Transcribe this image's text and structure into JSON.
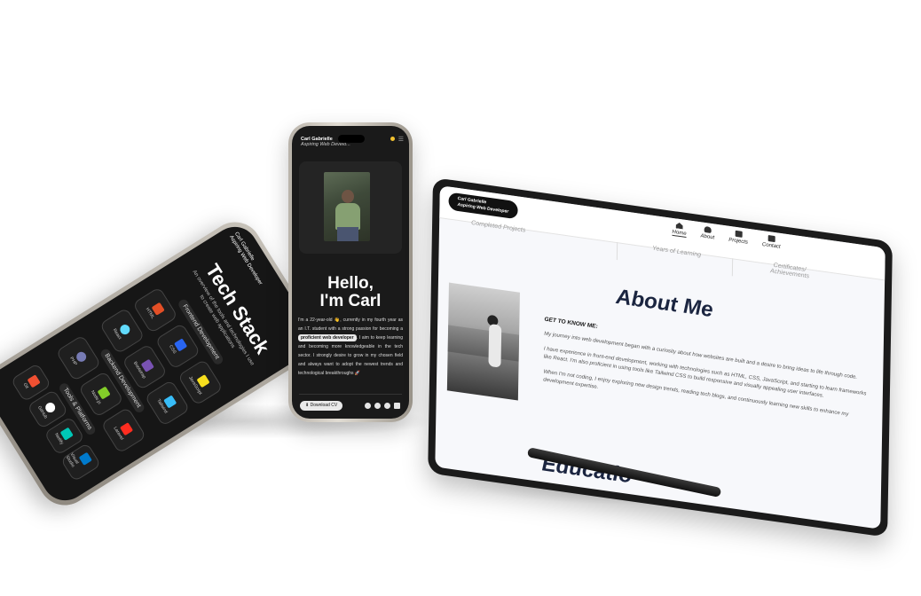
{
  "left_phone": {
    "header": [
      "Carl Gabrielle",
      "Aspiring Web Developer"
    ],
    "title": "Tech Stack",
    "subtitle": "An overview of the tools and technologies I use to create web applications",
    "sections": [
      {
        "label": "Frontend Development",
        "items": [
          {
            "name": "HTML",
            "color": "#e34f26"
          },
          {
            "name": "CSS",
            "color": "#2965f1"
          },
          {
            "name": "JavaScript",
            "color": "#f7df1e"
          },
          {
            "name": "React",
            "color": "#61dafb"
          },
          {
            "name": "Bootstrap",
            "color": "#7952b3"
          },
          {
            "name": "Tailwind",
            "color": "#38bdf8"
          }
        ]
      },
      {
        "label": "Backend Development",
        "items": [
          {
            "name": "PHP",
            "color": "#777bb4"
          },
          {
            "name": "Node.js",
            "color": "#83cd29"
          },
          {
            "name": "Laravel",
            "color": "#ff2d20"
          }
        ]
      },
      {
        "label": "Tools & Platforms",
        "items": [
          {
            "name": "Git",
            "color": "#f05032"
          },
          {
            "name": "GitHub",
            "color": "#ffffff"
          },
          {
            "name": "Netlify",
            "color": "#00c7b7"
          },
          {
            "name": "Visual Studio",
            "color": "#007acc"
          }
        ]
      }
    ]
  },
  "middle_phone": {
    "name": "Carl Gabrielle",
    "role": "Aspiring Web Develo...",
    "hello": [
      "Hello,",
      "I'm Carl"
    ],
    "paragraph_before": "I'm a 22-year-old 👋, currently in my fourth year as an I.T. student with a strong passion for becoming a",
    "highlight": "proficient web developer",
    "paragraph_after": ". I aim to keep learning and becoming more knowledgeable in the tech sector. I strongly desire to grow in my chosen field and always want to adopt the newest trends and technological breakthroughs 🚀",
    "cv_button": "⬇ Download CV",
    "social": [
      "facebook-icon",
      "instagram-icon",
      "github-icon",
      "linkedin-icon"
    ]
  },
  "tablet": {
    "brand_name": "Carl Gabrielle",
    "brand_role": "Aspiring Web Developer",
    "nav": [
      {
        "label": "Home",
        "icon": "home-icon",
        "active": true
      },
      {
        "label": "About",
        "icon": "user-icon",
        "active": false
      },
      {
        "label": "Projects",
        "icon": "projects-icon",
        "active": false
      },
      {
        "label": "Contact",
        "icon": "mail-icon",
        "active": false
      }
    ],
    "faded_labels": [
      "Completed Projects",
      "Years of Learning",
      "Certificates/ Achievements"
    ],
    "heading": "About Me",
    "get_to_know": "GET TO KNOW ME:",
    "paragraphs": [
      "My journey into web development began with a curiosity about how websites are built and a desire to bring ideas to life through code.",
      "I have experience in front-end development, working with technologies such as HTML, CSS, JavaScript, and starting to learn frameworks like React. I'm also proficient in using tools like Tailwind CSS to build responsive and visually appealing user interfaces.",
      "When I'm not coding, I enjoy exploring new design trends, reading tech blogs, and continuously learning new skills to enhance my development expertise."
    ],
    "next_heading": "Educatio"
  }
}
